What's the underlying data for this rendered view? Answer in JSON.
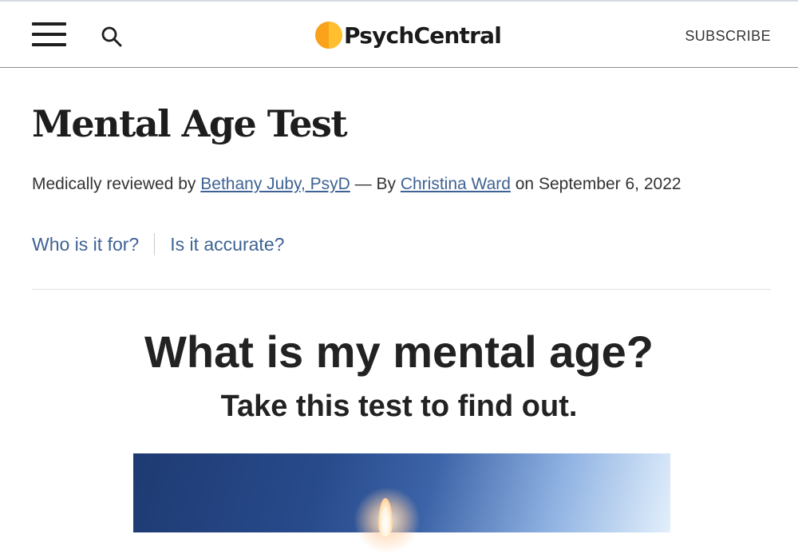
{
  "header": {
    "logo_text": "PsychCentral",
    "subscribe_label": "SUBSCRIBE",
    "menu_icon": "hamburger-menu-icon",
    "search_icon": "search-icon",
    "logo_colors": [
      "#f9a21a",
      "#ffbf2e"
    ]
  },
  "article": {
    "title": "Mental Age Test",
    "byline": {
      "prefix": "Medically reviewed by ",
      "reviewer": "Bethany Juby, PsyD",
      "middle": " — By ",
      "author": "Christina Ward",
      "date_text": " on September 6, 2022"
    },
    "jump_links": [
      "Who is it for?",
      "Is it accurate?"
    ],
    "link_color": "#3e6293"
  },
  "quiz": {
    "headline": "What is my mental age?",
    "subhead": "Take this test to find out."
  }
}
